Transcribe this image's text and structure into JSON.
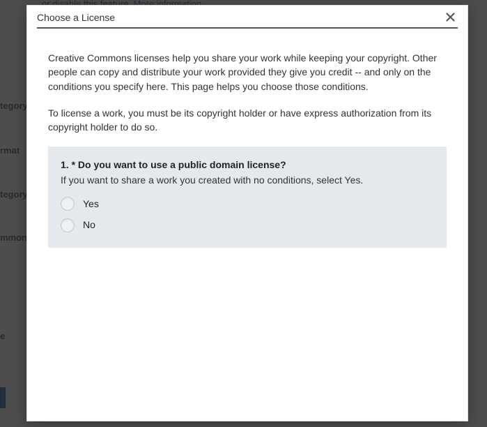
{
  "background": {
    "top_line_prefix": "or ",
    "top_line_link1": "disable",
    "top_line_middle": " this feature. ",
    "top_line_link2": "More information",
    "labels": [
      "tegory",
      "rmat",
      "tegory",
      "mmon",
      "e"
    ]
  },
  "modal": {
    "title": "Choose a License",
    "intro_p1": "Creative Commons licenses help you share your work while keeping your copyright. Other people can copy and distribute your work provided they give you credit -- and only on the conditions you specify here. This page helps you choose those conditions.",
    "intro_p2": "To license a work, you must be its copyright holder or have express authorization from its copyright holder to do so.",
    "question": {
      "number_prefix": "1. * ",
      "title": "Do you want to use a public domain license?",
      "subtitle": "If you want to share a work you created with no conditions, select Yes.",
      "options": {
        "yes": "Yes",
        "no": "No"
      }
    }
  }
}
